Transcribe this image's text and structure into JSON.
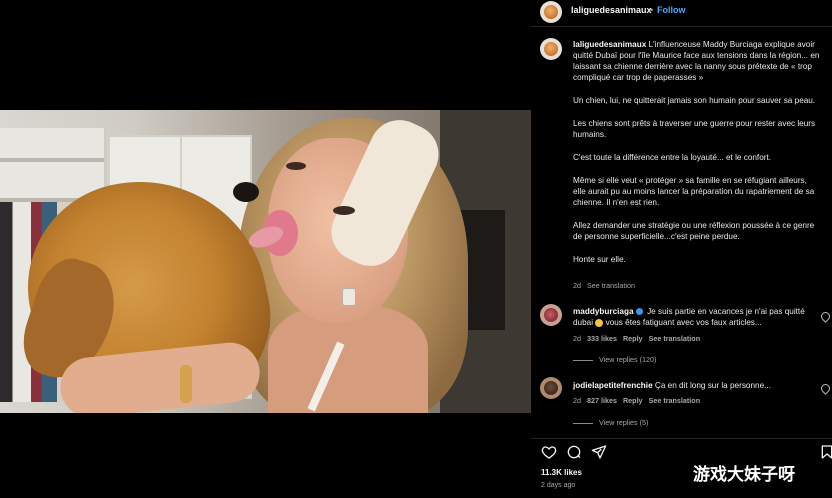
{
  "header": {
    "username": "laliguedesanimaux",
    "separator": "•",
    "follow_label": "Follow"
  },
  "caption": {
    "username": "laliguedesanimaux",
    "paragraphs": [
      "L'influenceuse Maddy Burciaga explique avoir quitté Dubaï pour l'île Maurice face aux tensions dans la région... en laissant sa chienne derrière avec la nanny sous prétexte de « trop compliqué car trop de paperasses »",
      "Un chien, lui, ne quitterait jamais son humain pour sauver sa peau.",
      "Les chiens sont prêts à traverser une guerre pour rester avec leurs humains.",
      "C'est toute la différence entre la loyauté... et le confort.",
      "Même si elle veut « protéger » sa famille en se réfugiant ailleurs, elle aurait pu au moins lancer la préparation du rapatriement de sa chienne. Il n'en est rien.",
      "Allez demander une stratégie ou une réflexion poussée à ce genre de personne superficielle...c'est peine perdue.",
      "Honte sur elle."
    ],
    "age": "2d",
    "see_translation": "See translation"
  },
  "comments": [
    {
      "username": "maddyburciaga",
      "text": "Je suis partie en vacances je n'ai pas quitté dubai",
      "text_tail": "vous êtes fatiguant avec vos faux articles...",
      "age": "2d",
      "likes": "333 likes",
      "reply": "Reply",
      "see_translation": "See translation",
      "view_replies": "View replies (120)"
    },
    {
      "username": "jodielapetitefrenchie",
      "text": "Ça en dit long sur la personne...",
      "age": "2d",
      "likes": "827 likes",
      "reply": "Reply",
      "see_translation": "See translation",
      "view_replies": "View replies (5)"
    }
  ],
  "footer": {
    "likes": "11.3K likes",
    "date": "2 days ago"
  },
  "watermark": "游戏大妹子呀",
  "icons": [
    "heart-icon",
    "comment-icon",
    "share-icon",
    "bookmark-icon",
    "verified-icon",
    "emoji-icon"
  ],
  "colors": {
    "background": "#000000",
    "follow_blue": "#4aa8ff",
    "muted_text": "#a8a8a8",
    "verified_blue": "#3897f0"
  }
}
